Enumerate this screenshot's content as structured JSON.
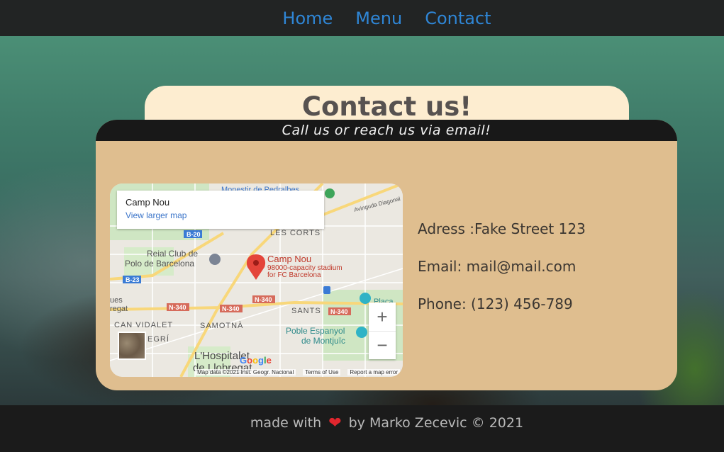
{
  "nav": {
    "items": [
      "Home",
      "Menu",
      "Contact"
    ]
  },
  "header": {
    "title": "Contact us!",
    "subtitle": "Call us or reach us via email!"
  },
  "map": {
    "place_name": "Camp Nou",
    "view_larger": "View larger map",
    "marker_label": "Camp Nou",
    "marker_desc1": "98000-capacity stadium",
    "marker_desc2": "for FC Barcelona",
    "labels": {
      "pedralbes": "Monestir de Pedralbes",
      "corts": "LES CORTS",
      "reial1": "Reial Club de",
      "reial2": "Polo de Barcelona",
      "diagonal": "Avinguda Diagonal",
      "sants": "SANTS",
      "samotna": "SAMOTNÀ",
      "vidalet": "CAN VIDALET",
      "egri": "EGRÍ",
      "poble1": "Poble Espanyol",
      "poble2": "de Montjuïc",
      "placa": "Plaça",
      "hosp1": "L'Hospitalet",
      "hosp2": "de Llobregat",
      "ues": "ues",
      "regat": "regat",
      "roads": [
        "B-20",
        "B-23",
        "N-340",
        "N-340",
        "N-340",
        "N-340"
      ]
    },
    "google": "Google",
    "attribution": [
      "Map data ©2021 Inst. Geogr. Nacional",
      "Terms of Use",
      "Report a map error"
    ],
    "zoom_in": "+",
    "zoom_out": "−"
  },
  "contact": {
    "address": "Adress :Fake Street 123",
    "email": "Email: mail@mail.com",
    "phone": "Phone: (123) 456-789"
  },
  "footer": {
    "before": "made with",
    "heart": "❤",
    "after": "by Marko Zecevic © 2021"
  },
  "colors": {
    "nav_link": "#2f86d6",
    "card": "#dfbe8f",
    "title_tab": "#fdedd0",
    "bar": "#181818",
    "heart": "#e0262e"
  }
}
